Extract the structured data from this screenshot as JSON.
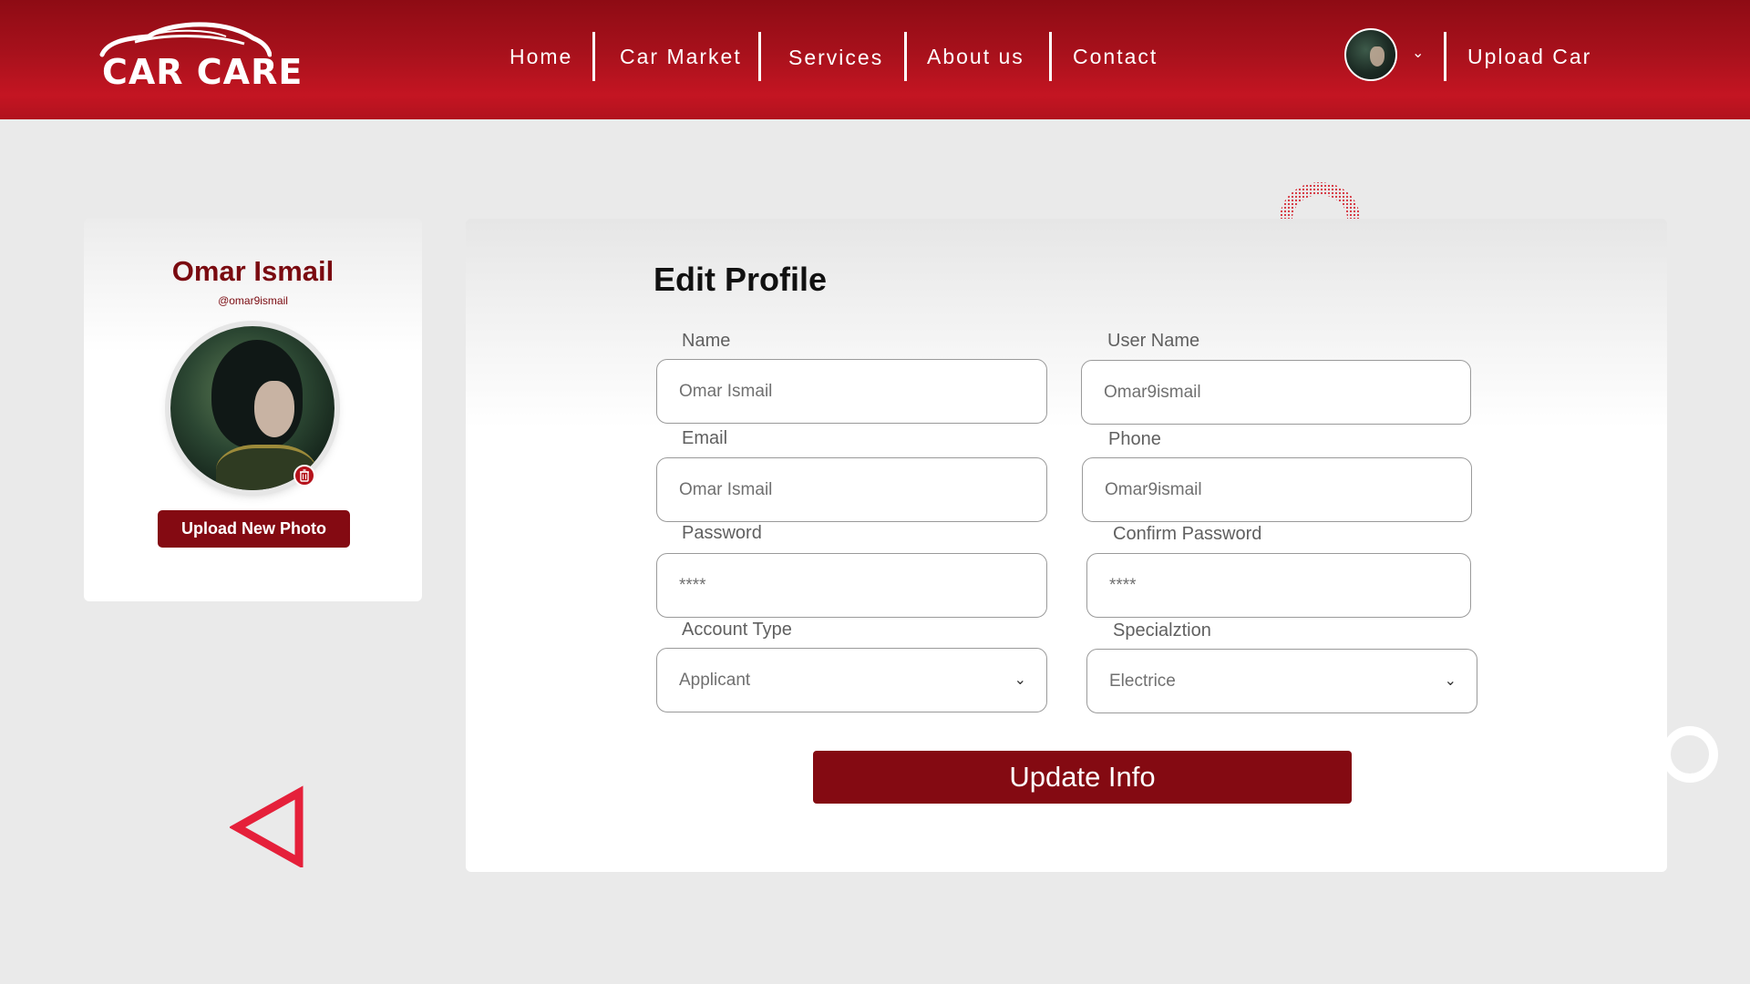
{
  "header": {
    "logo_text": "CAR CARE",
    "nav": [
      "Home",
      "Car Market",
      "Services",
      "About us",
      "Contact"
    ],
    "upload_car": "Upload Car",
    "user_menu_chevron": "chevron-down-icon"
  },
  "profile": {
    "name": "Omar Ismail",
    "handle": "@omar9ismail",
    "upload_photo_label": "Upload New Photo",
    "delete_icon": "trash-icon"
  },
  "form": {
    "title": "Edit Profile",
    "name": {
      "label": "Name",
      "value": "Omar Ismail"
    },
    "username": {
      "label": "User Name",
      "value": "Omar9ismail"
    },
    "email": {
      "label": "Email",
      "value": "Omar Ismail"
    },
    "phone": {
      "label": "Phone",
      "value": "Omar9ismail"
    },
    "password": {
      "label": "Password",
      "value": "****"
    },
    "confirm_password": {
      "label": "Confirm Password",
      "value": "****"
    },
    "account_type": {
      "label": "Account Type",
      "value": "Applicant"
    },
    "specialization": {
      "label": "Specialztion",
      "value": "Electrice"
    },
    "submit_label": "Update Info"
  },
  "colors": {
    "brand": "#a8111c",
    "button": "#840a12",
    "name_text": "#7a0a10",
    "accent_triangle": "#e5203a"
  }
}
